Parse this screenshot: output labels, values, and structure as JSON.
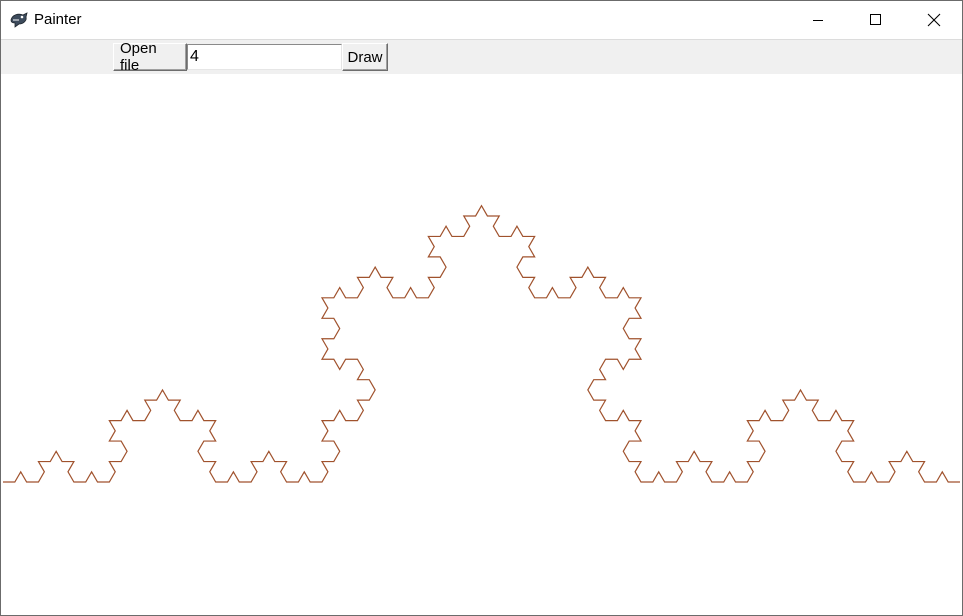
{
  "window": {
    "title": "Painter",
    "app_icon": "painter-brush-icon",
    "controls": [
      "minimize-icon",
      "maximize-icon",
      "close-icon"
    ]
  },
  "toolbar": {
    "open_label": "Open file",
    "entry_value": "4",
    "draw_label": "Draw"
  },
  "canvas": {
    "figure": "koch curve",
    "iterations": 4,
    "stroke_color": "#a0522d",
    "background": "#ffffff"
  }
}
